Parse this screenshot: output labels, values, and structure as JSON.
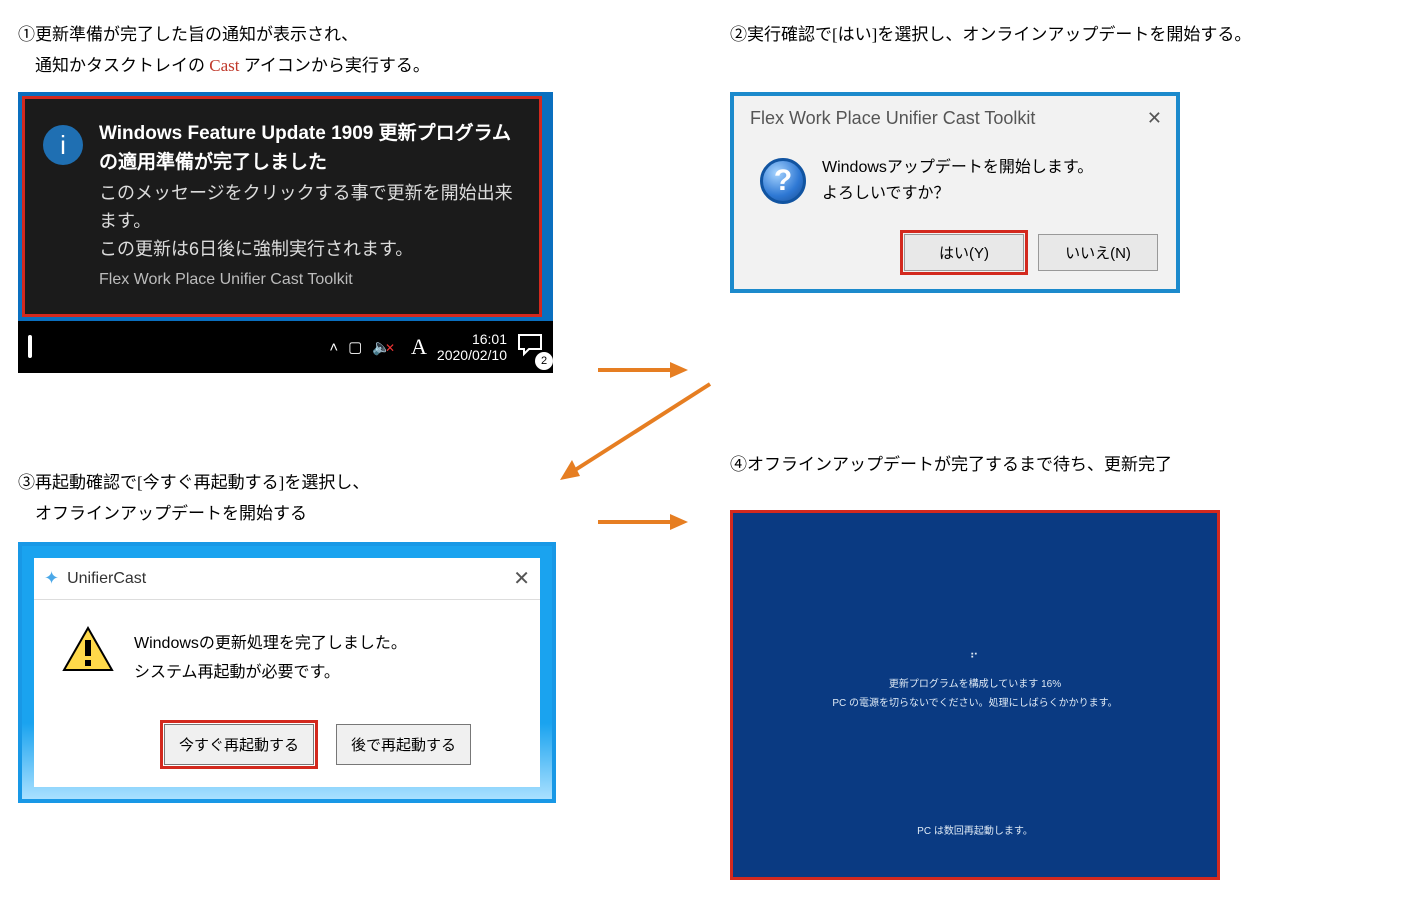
{
  "step1": {
    "caption_line1": "①更新準備が完了した旨の通知が表示され、",
    "caption_line2_a": "通知かタスクトレイの ",
    "caption_line2_cast": "Cast",
    "caption_line2_b": " アイコンから実行する。",
    "toast": {
      "title": "Windows Feature Update 1909 更新プログラムの適用準備が完了しました",
      "body": "このメッセージをクリックする事で更新を開始出来ます。\nこの更新は6日後に強制実行されます。",
      "app": "Flex Work Place Unifier Cast Toolkit"
    },
    "taskbar": {
      "ime": "A",
      "time": "16:01",
      "date": "2020/02/10",
      "notif_count": "2"
    }
  },
  "step2": {
    "caption": "②実行確認で[はい]を選択し、オンラインアップデートを開始する。",
    "title": "Flex Work Place Unifier Cast Toolkit",
    "body_l1": "Windowsアップデートを開始します。",
    "body_l2": "よろしいですか？",
    "yes": "はい(Y)",
    "no": "いいえ(N)"
  },
  "step3": {
    "caption_line1": "③再起動確認で[今すぐ再起動する]を選択し、",
    "caption_line2": "オフラインアップデートを開始する",
    "title": "UnifierCast",
    "body_l1": "Windowsの更新処理を完了しました。",
    "body_l2": "システム再起動が必要です。",
    "now": "今すぐ再起動する",
    "later": "後で再起動する"
  },
  "step4": {
    "caption": "④オフラインアップデートが完了するまで待ち、更新完了",
    "line1": "更新プログラムを構成しています 16%",
    "line2": "PC の電源を切らないでください。処理にしばらくかかります。",
    "bottom": "PC は数回再起動します。"
  }
}
